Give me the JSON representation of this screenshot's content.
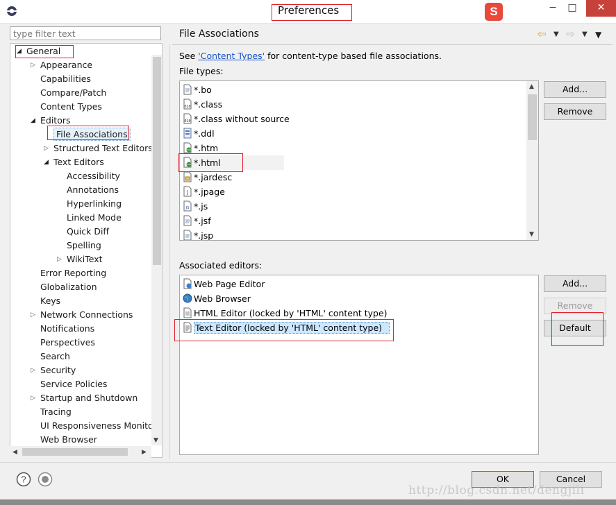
{
  "window": {
    "title": "Preferences",
    "brand_glyph": "S",
    "controls": {
      "minimize": "−",
      "maximize": "□",
      "close": "✕"
    }
  },
  "filter": {
    "placeholder": "type filter text"
  },
  "tree": {
    "items": [
      {
        "label": "General",
        "level": 0,
        "twisty": "open"
      },
      {
        "label": "Appearance",
        "level": 1,
        "twisty": "closed"
      },
      {
        "label": "Capabilities",
        "level": 1,
        "twisty": "none"
      },
      {
        "label": "Compare/Patch",
        "level": 1,
        "twisty": "none"
      },
      {
        "label": "Content Types",
        "level": 1,
        "twisty": "none"
      },
      {
        "label": "Editors",
        "level": 1,
        "twisty": "open"
      },
      {
        "label": "File Associations",
        "level": 2,
        "twisty": "none",
        "selected": true
      },
      {
        "label": "Structured Text Editors",
        "level": 2,
        "twisty": "closed"
      },
      {
        "label": "Text Editors",
        "level": 2,
        "twisty": "open"
      },
      {
        "label": "Accessibility",
        "level": 3,
        "twisty": "none"
      },
      {
        "label": "Annotations",
        "level": 3,
        "twisty": "none"
      },
      {
        "label": "Hyperlinking",
        "level": 3,
        "twisty": "none"
      },
      {
        "label": "Linked Mode",
        "level": 3,
        "twisty": "none"
      },
      {
        "label": "Quick Diff",
        "level": 3,
        "twisty": "none"
      },
      {
        "label": "Spelling",
        "level": 3,
        "twisty": "none"
      },
      {
        "label": "WikiText",
        "level": 3,
        "twisty": "closed"
      },
      {
        "label": "Error Reporting",
        "level": 1,
        "twisty": "none"
      },
      {
        "label": "Globalization",
        "level": 1,
        "twisty": "none"
      },
      {
        "label": "Keys",
        "level": 1,
        "twisty": "none"
      },
      {
        "label": "Network Connections",
        "level": 1,
        "twisty": "closed"
      },
      {
        "label": "Notifications",
        "level": 1,
        "twisty": "none"
      },
      {
        "label": "Perspectives",
        "level": 1,
        "twisty": "none"
      },
      {
        "label": "Search",
        "level": 1,
        "twisty": "none"
      },
      {
        "label": "Security",
        "level": 1,
        "twisty": "closed"
      },
      {
        "label": "Service Policies",
        "level": 1,
        "twisty": "none"
      },
      {
        "label": "Startup and Shutdown",
        "level": 1,
        "twisty": "closed"
      },
      {
        "label": "Tracing",
        "level": 1,
        "twisty": "none"
      },
      {
        "label": "UI Responsiveness Monitor",
        "level": 1,
        "twisty": "none"
      },
      {
        "label": "Web Browser",
        "level": 1,
        "twisty": "none"
      }
    ]
  },
  "page": {
    "title": "File Associations",
    "see_prefix": "See ",
    "see_link": "'Content Types'",
    "see_suffix": " for content-type based file associations.",
    "file_types_label": "File types:",
    "associated_label": "Associated editors:",
    "file_types": [
      {
        "name": "*.bo",
        "icon": "doc-icon"
      },
      {
        "name": "*.class",
        "icon": "class-file-icon"
      },
      {
        "name": "*.class without source",
        "icon": "class-file-icon"
      },
      {
        "name": "*.ddl",
        "icon": "ddl-icon"
      },
      {
        "name": "*.htm",
        "icon": "web-doc-icon"
      },
      {
        "name": "*.html",
        "icon": "web-doc-icon",
        "selected": true
      },
      {
        "name": "*.jardesc",
        "icon": "jar-icon"
      },
      {
        "name": "*.jpage",
        "icon": "java-page-icon"
      },
      {
        "name": "*.js",
        "icon": "js-icon"
      },
      {
        "name": "*.jsf",
        "icon": "doc-icon"
      },
      {
        "name": "*.jsp",
        "icon": "doc-icon"
      }
    ],
    "editors": [
      {
        "name": "Web Page Editor",
        "icon": "web-page-editor-icon"
      },
      {
        "name": "Web Browser",
        "icon": "globe-icon"
      },
      {
        "name": "HTML Editor (locked by 'HTML' content type)",
        "icon": "html-editor-icon"
      },
      {
        "name": "Text Editor (locked by 'HTML' content type)",
        "icon": "text-editor-icon",
        "selected": true
      }
    ],
    "buttons": {
      "add": "Add...",
      "remove": "Remove",
      "add2": "Add...",
      "remove2": "Remove",
      "default": "Default"
    }
  },
  "footer": {
    "ok": "OK",
    "cancel": "Cancel",
    "help_glyph": "?"
  },
  "watermark": "http://blog.csdn.net/dengjili",
  "colors": {
    "selection": "#cce8ff",
    "annotation": "#e0202a",
    "link": "#1a56c8"
  }
}
